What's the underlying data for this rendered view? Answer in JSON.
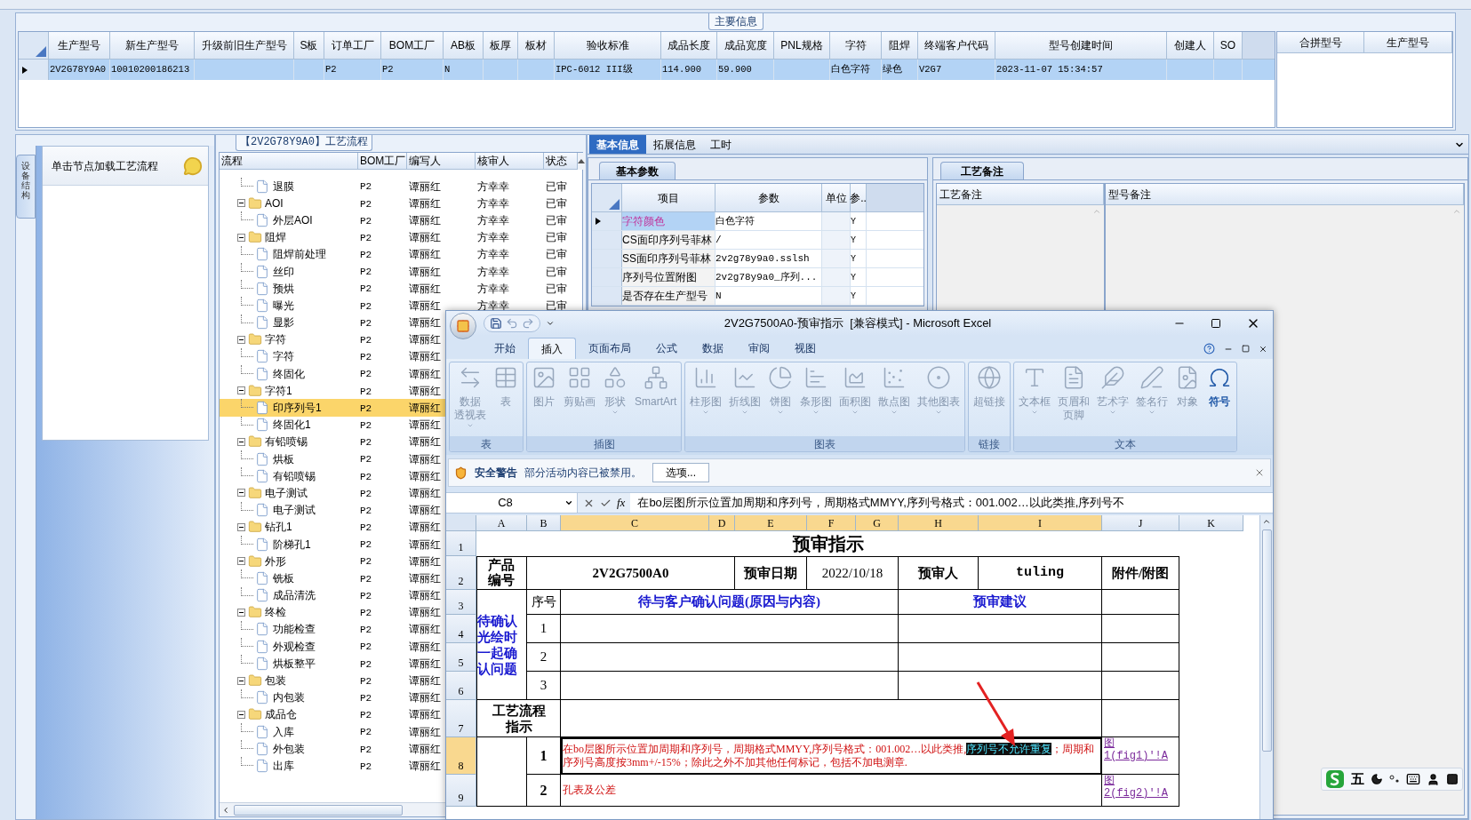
{
  "main_info": {
    "title": "主要信息",
    "columns": [
      "生产型号",
      "新生产型号",
      "升级前旧生产型号",
      "S板",
      "订单工厂",
      "BOM工厂",
      "AB板",
      "板厚",
      "板材",
      "验收标准",
      "成品长度",
      "成品宽度",
      "PNL规格",
      "字符",
      "阻焊",
      "终端客户代码",
      "型号创建时间",
      "创建人",
      "SO"
    ],
    "rows": [
      {
        "selected": true,
        "cells": [
          "2V2G78Y9A0",
          "10010200186213",
          "",
          "",
          "P2",
          "P2",
          "N",
          "",
          "",
          "IPC-6012 III级",
          "114.900",
          "59.900",
          "",
          "白色字符",
          "绿色",
          "V2G7",
          "2023-11-07 15:34:57",
          "",
          ""
        ]
      }
    ],
    "side_columns": [
      "合拼型号",
      "生产型号"
    ]
  },
  "side_panel": {
    "tab": "设备结构",
    "hint": "单击节点加载工艺流程"
  },
  "tree": {
    "title": "【2V2G78Y9A0】工艺流程",
    "columns": [
      "流程",
      "BOM工厂",
      "编写人",
      "核审人",
      "状态"
    ],
    "nodes": [
      {
        "children": [
          {
            "label": "退膜",
            "bom": "P2",
            "writer": "谭丽红",
            "reviewer": "方幸幸",
            "status": "已审",
            "selected": false
          }
        ]
      },
      {
        "label": "AOI",
        "bom": "P2",
        "writer": "谭丽红",
        "reviewer": "方幸幸",
        "status": "已审",
        "selected": false,
        "expanded": true,
        "children": [
          {
            "label": "外层AOI",
            "bom": "P2",
            "writer": "谭丽红",
            "reviewer": "方幸幸",
            "status": "已审",
            "selected": false
          }
        ]
      },
      {
        "label": "阻焊",
        "bom": "P2",
        "writer": "谭丽红",
        "reviewer": "方幸幸",
        "status": "已审",
        "selected": false,
        "expanded": true,
        "children": [
          {
            "label": "阻焊前处理",
            "bom": "P2",
            "writer": "谭丽红",
            "reviewer": "方幸幸",
            "status": "已审",
            "selected": false
          },
          {
            "label": "丝印",
            "bom": "P2",
            "writer": "谭丽红",
            "reviewer": "方幸幸",
            "status": "已审",
            "selected": false
          },
          {
            "label": "预烘",
            "bom": "P2",
            "writer": "谭丽红",
            "reviewer": "方幸幸",
            "status": "已审",
            "selected": false
          },
          {
            "label": "曝光",
            "bom": "P2",
            "writer": "谭丽红",
            "reviewer": "方幸幸",
            "status": "已审",
            "selected": false
          },
          {
            "label": "显影",
            "bom": "P2",
            "writer": "谭丽红",
            "selected": false
          }
        ]
      },
      {
        "label": "字符",
        "bom": "P2",
        "writer": "谭丽红",
        "selected": false,
        "expanded": true,
        "children": [
          {
            "label": "字符",
            "bom": "P2",
            "writer": "谭丽红",
            "selected": false
          },
          {
            "label": "终固化",
            "bom": "P2",
            "writer": "谭丽红",
            "selected": false
          }
        ]
      },
      {
        "label": "字符1",
        "bom": "P2",
        "writer": "谭丽红",
        "selected": false,
        "expanded": true,
        "children": [
          {
            "label": "印序列号1",
            "bom": "P2",
            "writer": "谭丽红",
            "selected": true
          },
          {
            "label": "终固化1",
            "bom": "P2",
            "writer": "谭丽红",
            "selected": false
          }
        ]
      },
      {
        "label": "有铅喷锡",
        "bom": "P2",
        "writer": "谭丽红",
        "selected": false,
        "expanded": true,
        "children": [
          {
            "label": "烘板",
            "bom": "P2",
            "writer": "谭丽红",
            "selected": false
          },
          {
            "label": "有铅喷锡",
            "bom": "P2",
            "writer": "谭丽红",
            "selected": false
          }
        ]
      },
      {
        "label": "电子测试",
        "bom": "P2",
        "writer": "谭丽红",
        "selected": false,
        "expanded": true,
        "children": [
          {
            "label": "电子测试",
            "bom": "P2",
            "writer": "谭丽红",
            "selected": false
          }
        ]
      },
      {
        "label": "钻孔1",
        "bom": "P2",
        "writer": "谭丽红",
        "selected": false,
        "expanded": true,
        "children": [
          {
            "label": "阶梯孔1",
            "bom": "P2",
            "writer": "谭丽红",
            "selected": false
          }
        ]
      },
      {
        "label": "外形",
        "bom": "P2",
        "writer": "谭丽红",
        "selected": false,
        "expanded": true,
        "children": [
          {
            "label": "铣板",
            "bom": "P2",
            "writer": "谭丽红",
            "selected": false
          },
          {
            "label": "成品清洗",
            "bom": "P2",
            "writer": "谭丽红",
            "selected": false
          }
        ]
      },
      {
        "label": "终检",
        "bom": "P2",
        "writer": "谭丽红",
        "selected": false,
        "expanded": true,
        "children": [
          {
            "label": "功能检查",
            "bom": "P2",
            "writer": "谭丽红",
            "selected": false
          },
          {
            "label": "外观检查",
            "bom": "P2",
            "writer": "谭丽红",
            "selected": false
          },
          {
            "label": "烘板整平",
            "bom": "P2",
            "writer": "谭丽红",
            "selected": false
          }
        ]
      },
      {
        "label": "包装",
        "bom": "P2",
        "writer": "谭丽红",
        "selected": false,
        "expanded": true,
        "children": [
          {
            "label": "内包装",
            "bom": "P2",
            "writer": "谭丽红",
            "selected": false
          }
        ]
      },
      {
        "label": "成品仓",
        "bom": "P2",
        "writer": "谭丽红",
        "selected": false,
        "expanded": true,
        "children": [
          {
            "label": "入库",
            "bom": "P2",
            "writer": "谭丽红",
            "selected": false
          },
          {
            "label": "外包装",
            "bom": "P2",
            "writer": "谭丽红",
            "selected": false
          },
          {
            "label": "出库",
            "bom": "P2",
            "writer": "谭丽红",
            "selected": false
          }
        ]
      }
    ]
  },
  "detail_tabs": [
    {
      "label": "基本信息",
      "selected": true
    },
    {
      "label": "拓展信息",
      "selected": false
    },
    {
      "label": "工时",
      "selected": false
    }
  ],
  "basic_params": {
    "tab": "基本参数",
    "columns": [
      "项目",
      "参数",
      "单位",
      "参.."
    ],
    "rows": [
      {
        "item": "字符颜色",
        "value": "白色字符",
        "flag": "Y",
        "selected": true
      },
      {
        "item": "CS面印序列号菲林",
        "value": "/",
        "flag": "Y",
        "selected": false
      },
      {
        "item": "SS面印序列号菲林",
        "value": "2v2g78y9a0.sslsh",
        "flag": "Y",
        "selected": false
      },
      {
        "item": "序列号位置附图",
        "value": "2v2g78y9a0_序列...",
        "flag": "Y",
        "selected": false
      },
      {
        "item": "是否存在生产型号",
        "value": "N",
        "flag": "Y",
        "selected": false
      }
    ]
  },
  "remarks": {
    "tab": "工艺备注",
    "columns": [
      "工艺备注",
      "型号备注"
    ]
  },
  "excel": {
    "title": "2V2G7500A0-预审指示  [兼容模式] - Microsoft Excel",
    "tabs": [
      {
        "label": "开始",
        "selected": false
      },
      {
        "label": "插入",
        "selected": true
      },
      {
        "label": "页面布局",
        "selected": false
      },
      {
        "label": "公式",
        "selected": false
      },
      {
        "label": "数据",
        "selected": false
      },
      {
        "label": "审阅",
        "selected": false
      },
      {
        "label": "视图",
        "selected": false
      }
    ],
    "ribbon": [
      {
        "label": "表",
        "items": [
          {
            "lines": [
              "数据",
              "透视表"
            ],
            "has_menu": true,
            "disabled": true
          },
          {
            "lines": [
              "表"
            ],
            "has_menu": false,
            "disabled": true
          }
        ]
      },
      {
        "label": "插图",
        "items": [
          {
            "lines": [
              "图片"
            ],
            "has_menu": false,
            "disabled": true
          },
          {
            "lines": [
              "剪贴画"
            ],
            "has_menu": false,
            "disabled": true
          },
          {
            "lines": [
              "形状"
            ],
            "has_menu": true,
            "disabled": true
          },
          {
            "lines": [
              "SmartArt"
            ],
            "has_menu": false,
            "disabled": true
          }
        ]
      },
      {
        "label": "图表",
        "items": [
          {
            "lines": [
              "柱形图"
            ],
            "has_menu": true,
            "disabled": true
          },
          {
            "lines": [
              "折线图"
            ],
            "has_menu": true,
            "disabled": true
          },
          {
            "lines": [
              "饼图"
            ],
            "has_menu": true,
            "disabled": true
          },
          {
            "lines": [
              "条形图"
            ],
            "has_menu": true,
            "disabled": true
          },
          {
            "lines": [
              "面积图"
            ],
            "has_menu": true,
            "disabled": true
          },
          {
            "lines": [
              "散点图"
            ],
            "has_menu": true,
            "disabled": true
          },
          {
            "lines": [
              "其他图表"
            ],
            "has_menu": true,
            "disabled": true
          }
        ]
      },
      {
        "label": "链接",
        "items": [
          {
            "lines": [
              "超链接"
            ],
            "has_menu": false,
            "disabled": true
          }
        ]
      },
      {
        "label": "文本",
        "items": [
          {
            "lines": [
              "文本框"
            ],
            "has_menu": true,
            "disabled": true
          },
          {
            "lines": [
              "页眉和",
              "页脚"
            ],
            "has_menu": false,
            "disabled": true
          },
          {
            "lines": [
              "艺术字"
            ],
            "has_menu": true,
            "disabled": true
          },
          {
            "lines": [
              "签名行"
            ],
            "has_menu": true,
            "disabled": true
          },
          {
            "lines": [
              "对象"
            ],
            "has_menu": false,
            "disabled": true
          },
          {
            "lines": [
              "符号"
            ],
            "has_menu": false,
            "disabled": false
          }
        ]
      }
    ],
    "security": {
      "title": "安全警告",
      "message": "部分活动内容已被禁用。",
      "button": "选项..."
    },
    "formula": {
      "cell": "C8",
      "fx": "fx",
      "text": "在bo层图所示位置加周期和序列号，周期格式MMYY,序列号格式：001.002…以此类推,序列号不"
    },
    "column_headers": [
      {
        "label": "A",
        "selected": false
      },
      {
        "label": "B",
        "selected": false
      },
      {
        "label": "C",
        "selected": true
      },
      {
        "label": "D",
        "selected": true
      },
      {
        "label": "E",
        "selected": true
      },
      {
        "label": "F",
        "selected": true
      },
      {
        "label": "G",
        "selected": true
      },
      {
        "label": "H",
        "selected": true
      },
      {
        "label": "I",
        "selected": true
      },
      {
        "label": "J",
        "selected": false
      },
      {
        "label": "K",
        "selected": false
      }
    ],
    "row_headers": [
      {
        "label": "1",
        "selected": false
      },
      {
        "label": "2",
        "selected": false
      },
      {
        "label": "3",
        "selected": false
      },
      {
        "label": "4",
        "selected": false
      },
      {
        "label": "5",
        "selected": false
      },
      {
        "label": "6",
        "selected": false
      },
      {
        "label": "7",
        "selected": false
      },
      {
        "label": "8",
        "selected": true
      },
      {
        "label": "9",
        "selected": false
      }
    ],
    "sheet": {
      "title": "预审指示",
      "product_label": "产品编号",
      "product_code": "2V2G7500A0",
      "date_label": "预审日期",
      "date": "2022/10/18",
      "reviewer_label": "预审人",
      "reviewer": "tuling",
      "attachment_label": "附件/附图",
      "seq_label": "序号",
      "question_header": "待与客户确认问题(原因与内容)",
      "suggestion_header": "预审建议",
      "pending_label": "待确认光绘时一起确认问题",
      "numbers": [
        "1",
        "2",
        "3"
      ],
      "process_label": "工艺流程指示",
      "process_rows": [
        {
          "no": "1",
          "text": "在bo层图所示位置加周期和序列号，周期格式MMYY,序列号格式：001.002…以此类推,",
          "highlight": "序列号不允许重复",
          "rest": "；周期和序列号高度按3mm+/-15%；除此之外不加其他任何标记，包括不加电测章.",
          "link": "图1(fig1)'!A"
        },
        {
          "no": "2",
          "text": "孔表及公差",
          "link": "图2(fig2)'!A"
        }
      ]
    }
  },
  "ime_bar": {
    "mode": "五"
  }
}
